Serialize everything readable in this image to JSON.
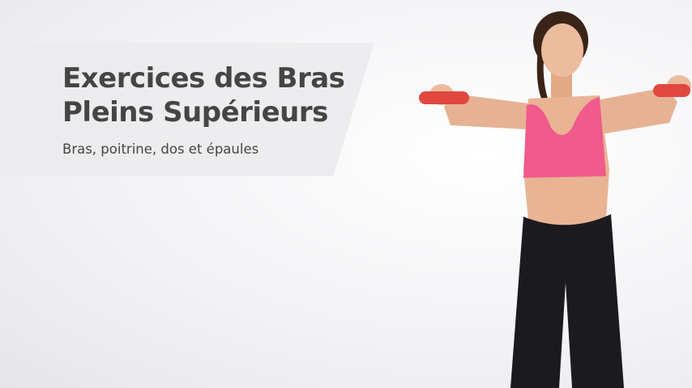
{
  "header": {
    "title": "Exercices des Bras Pleins Supérieurs",
    "subtitle": "Bras, poitrine, dos et épaules"
  },
  "illustration": {
    "subject": "woman-with-dumbbells",
    "colors": {
      "top": "#f05a8c",
      "dumbbells": "#e0483f",
      "leggings": "#1b1b1f",
      "skin": "#e9b493",
      "hair": "#3a2418"
    }
  }
}
